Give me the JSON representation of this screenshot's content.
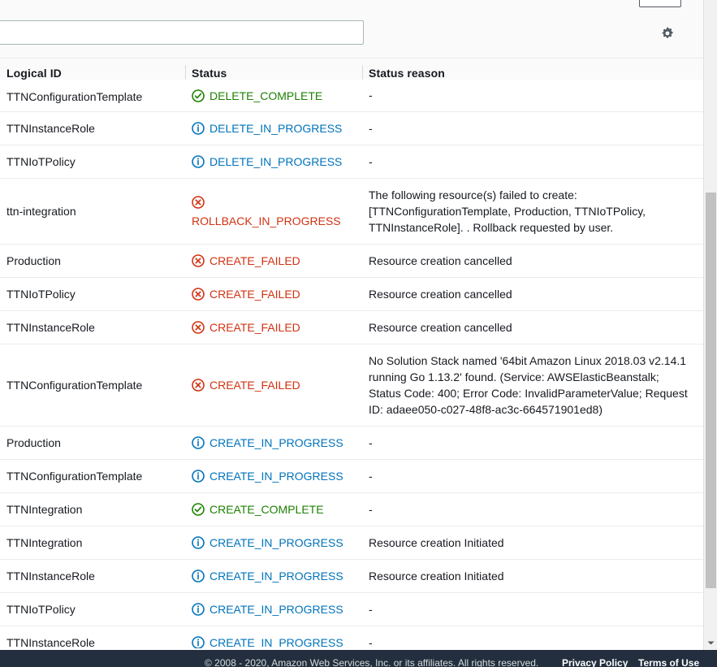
{
  "toolbar": {
    "search_placeholder": "",
    "search_value": "",
    "refresh_icon": "refresh-icon",
    "gear_icon": "gear-icon"
  },
  "table": {
    "columns": [
      "Logical ID",
      "Status",
      "Status reason"
    ],
    "rows": [
      {
        "logical_id": "TTNConfigurationTemplate",
        "status": "DELETE_COMPLETE",
        "status_kind": "complete",
        "status_icon": "check-circle-icon",
        "reason": "-",
        "clipped": true
      },
      {
        "logical_id": "TTNInstanceRole",
        "status": "DELETE_IN_PROGRESS",
        "status_kind": "in-progress",
        "status_icon": "info-circle-icon",
        "reason": "-"
      },
      {
        "logical_id": "TTNIoTPolicy",
        "status": "DELETE_IN_PROGRESS",
        "status_kind": "in-progress",
        "status_icon": "info-circle-icon",
        "reason": "-"
      },
      {
        "logical_id": "ttn-integration",
        "status": "ROLLBACK_IN_PROGRESS",
        "status_kind": "failed",
        "status_icon": "error-circle-icon",
        "status_wrap": true,
        "reason": "The following resource(s) failed to create: [TTNConfigurationTemplate, Production, TTNIoTPolicy, TTNInstanceRole]. . Rollback requested by user."
      },
      {
        "logical_id": "Production",
        "status": "CREATE_FAILED",
        "status_kind": "failed",
        "status_icon": "error-circle-icon",
        "reason": "Resource creation cancelled"
      },
      {
        "logical_id": "TTNIoTPolicy",
        "status": "CREATE_FAILED",
        "status_kind": "failed",
        "status_icon": "error-circle-icon",
        "reason": "Resource creation cancelled"
      },
      {
        "logical_id": "TTNInstanceRole",
        "status": "CREATE_FAILED",
        "status_kind": "failed",
        "status_icon": "error-circle-icon",
        "reason": "Resource creation cancelled"
      },
      {
        "logical_id": "TTNConfigurationTemplate",
        "status": "CREATE_FAILED",
        "status_kind": "failed",
        "status_icon": "error-circle-icon",
        "reason": "No Solution Stack named '64bit Amazon Linux 2018.03 v2.14.1 running Go 1.13.2' found. (Service: AWSElasticBeanstalk; Status Code: 400; Error Code: InvalidParameterValue; Request ID: adaee050-c027-48f8-ac3c-664571901ed8)"
      },
      {
        "logical_id": "Production",
        "status": "CREATE_IN_PROGRESS",
        "status_kind": "in-progress",
        "status_icon": "info-circle-icon",
        "reason": "-"
      },
      {
        "logical_id": "TTNConfigurationTemplate",
        "status": "CREATE_IN_PROGRESS",
        "status_kind": "in-progress",
        "status_icon": "info-circle-icon",
        "reason": "-"
      },
      {
        "logical_id": "TTNIntegration",
        "status": "CREATE_COMPLETE",
        "status_kind": "complete",
        "status_icon": "check-circle-icon",
        "reason": "-"
      },
      {
        "logical_id": "TTNIntegration",
        "status": "CREATE_IN_PROGRESS",
        "status_kind": "in-progress",
        "status_icon": "info-circle-icon",
        "reason": "Resource creation Initiated"
      },
      {
        "logical_id": "TTNInstanceRole",
        "status": "CREATE_IN_PROGRESS",
        "status_kind": "in-progress",
        "status_icon": "info-circle-icon",
        "reason": "Resource creation Initiated"
      },
      {
        "logical_id": "TTNIoTPolicy",
        "status": "CREATE_IN_PROGRESS",
        "status_kind": "in-progress",
        "status_icon": "info-circle-icon",
        "reason": "-"
      },
      {
        "logical_id": "TTNInstanceRole",
        "status": "CREATE_IN_PROGRESS",
        "status_kind": "in-progress",
        "status_icon": "info-circle-icon",
        "reason": "-"
      }
    ]
  },
  "footer": {
    "copyright": "© 2008 - 2020, Amazon Web Services, Inc. or its affiliates. All rights reserved.",
    "privacy_label": "Privacy Policy",
    "terms_label": "Terms of Use"
  },
  "colors": {
    "in_progress": "#0073bb",
    "failed": "#d13212",
    "complete": "#1d8102",
    "footer_bg": "#232f3e"
  }
}
